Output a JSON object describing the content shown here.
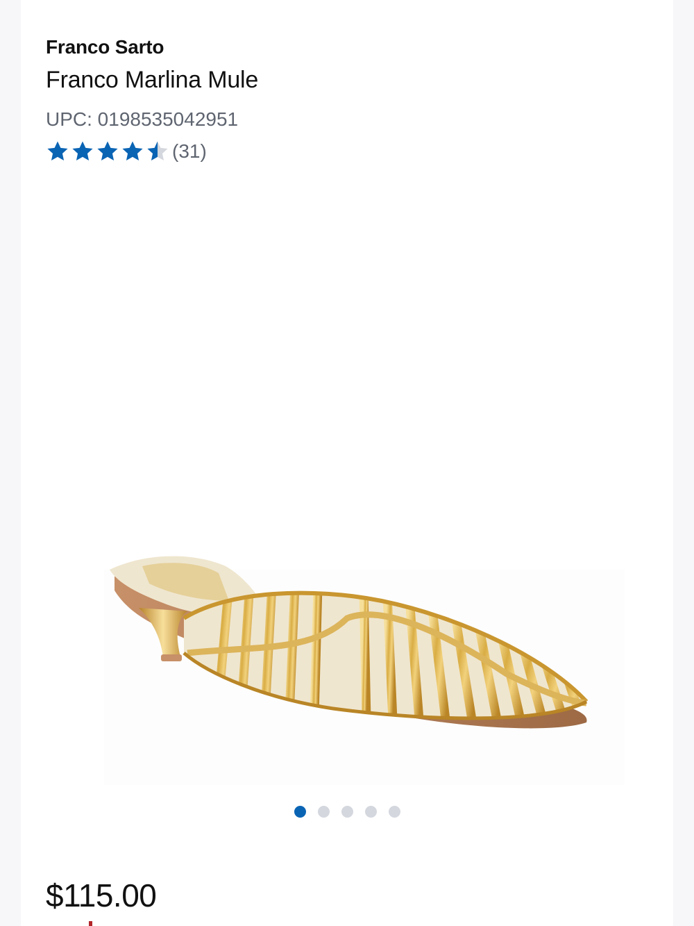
{
  "product": {
    "brand": "Franco Sarto",
    "name": "Franco Marlina Mule",
    "upc": "UPC: 0198535042951",
    "rating": 4.5,
    "rating_max": 5,
    "review_count": "(31)",
    "price": "$115.00"
  },
  "carousel": {
    "image_icon": "gold-caged-kitten-heel-mule",
    "slide_count": 5,
    "active_index": 0
  },
  "colors": {
    "star": "#0a64b4",
    "star_empty": "#d4d7de",
    "dot_active": "#0a64b4",
    "dot_inactive": "#d4d7de",
    "gold": "#d4a93a"
  }
}
